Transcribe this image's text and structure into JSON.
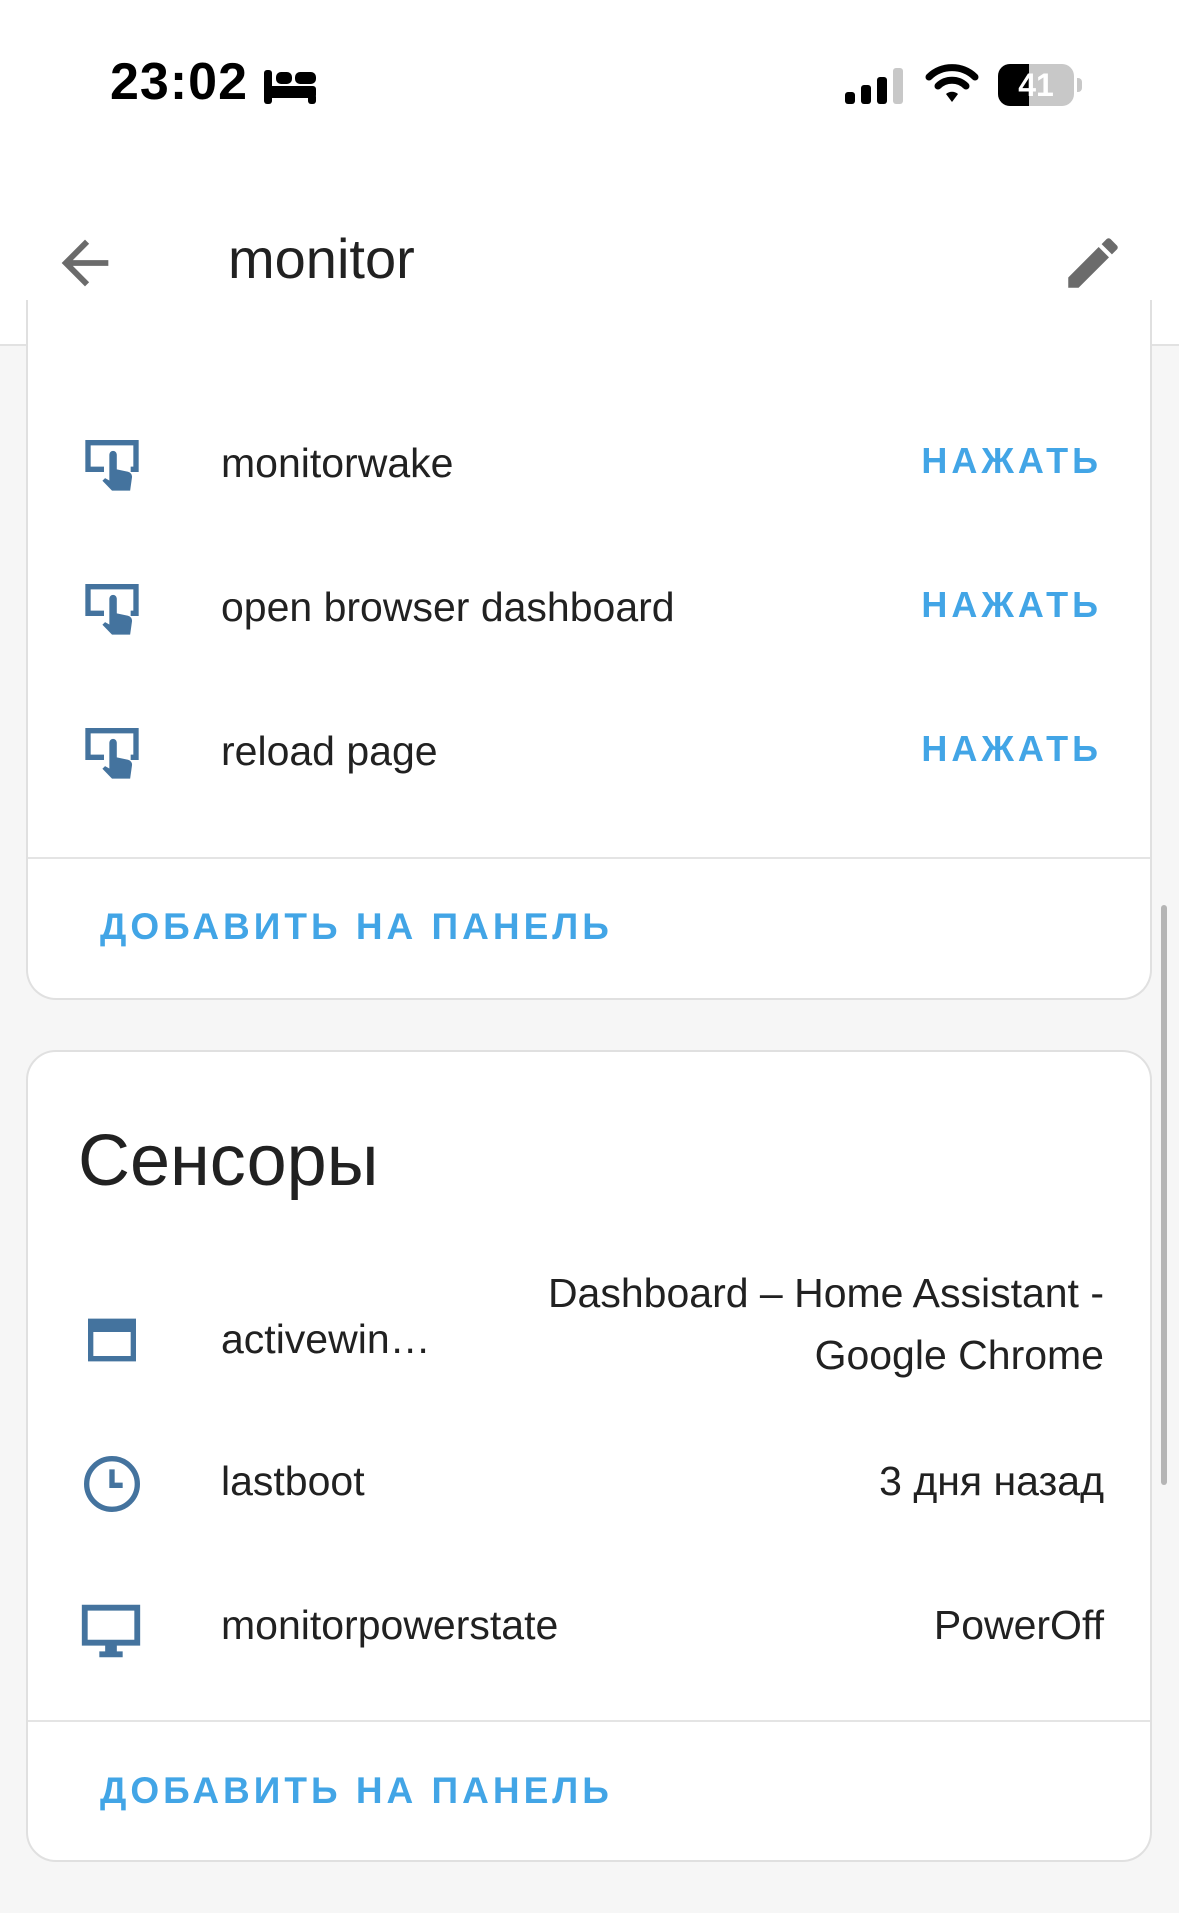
{
  "status_bar": {
    "time": "23:02",
    "battery_level": "41",
    "battery_fraction": 0.41,
    "icons": [
      "bed-icon",
      "signal-icon",
      "wifi-icon",
      "battery-icon"
    ]
  },
  "header": {
    "title": "monitor",
    "back_icon": "arrow-left-icon",
    "edit_icon": "pencil-icon"
  },
  "buttons_card": {
    "items": [
      {
        "label": "monitorwake",
        "action": "НАЖАТЬ",
        "icon": "gesture-tap-button-icon"
      },
      {
        "label": "open browser dashboard",
        "action": "НАЖАТЬ",
        "icon": "gesture-tap-button-icon"
      },
      {
        "label": "reload page",
        "action": "НАЖАТЬ",
        "icon": "gesture-tap-button-icon"
      }
    ],
    "add_label": "ДОБАВИТЬ НА ПАНЕЛЬ"
  },
  "sensors_card": {
    "title": "Сенсоры",
    "items": [
      {
        "label": "activewin…",
        "value_line1": "Dashboard – Home Assistant -",
        "value_line2": "Google Chrome",
        "icon": "window-icon"
      },
      {
        "label": "lastboot",
        "value": "3 дня назад",
        "icon": "clock-icon"
      },
      {
        "label": "monitorpowerstate",
        "value": "PowerOff",
        "icon": "monitor-icon"
      }
    ],
    "add_label": "ДОБАВИТЬ НА ПАНЕЛЬ"
  },
  "colors": {
    "accent": "#42a5e6",
    "icon": "#44739e",
    "background": "#f6f6f6",
    "card": "#ffffff"
  }
}
